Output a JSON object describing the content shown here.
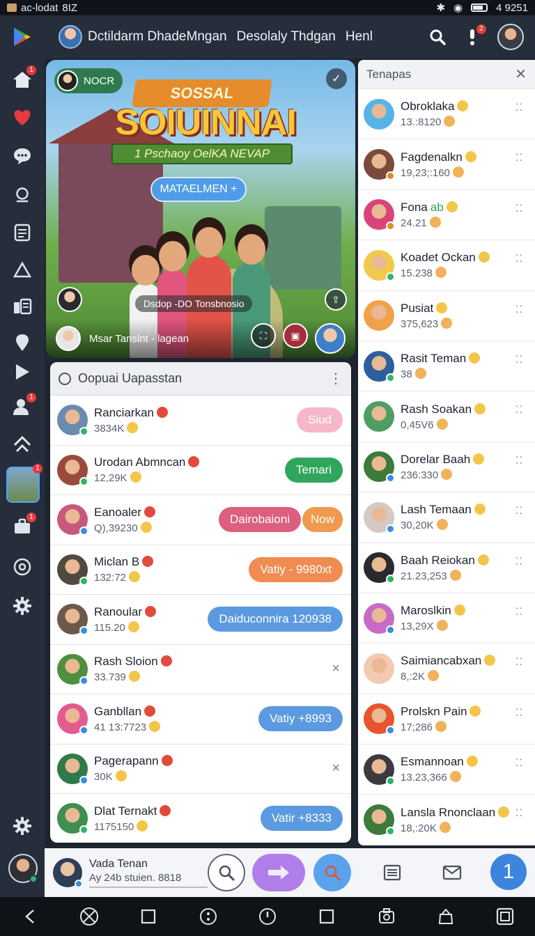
{
  "status_bar": {
    "carrier": "ac-lodat",
    "network": "8IZ",
    "time": "4 9251"
  },
  "header": {
    "title": "Dctildarm DhadeMngan",
    "subtitle": "Desolaly Thdgan",
    "extra": "Henl",
    "alerts_badge": "2"
  },
  "rail": {
    "home_badge": "1",
    "thumb_badge": "1",
    "briefcase_badge": "1"
  },
  "hero": {
    "chip_label": "NOCR",
    "banner": "SOSSAL",
    "title": "SOIUINNAI",
    "subtitle": "1 Pschaoy OelKA NEVAP",
    "pill": "MATAELMEN",
    "caption": "Dsdop -DO Tonsbnosio",
    "footer_name": "Msar Tanslnt - lagean"
  },
  "panel": {
    "title": "Oopuai Uapasstan",
    "rows": [
      {
        "name": "Ranciarkan",
        "sub": "3834K",
        "pill": "Siud",
        "pill_color": "#f6b8c8",
        "avatar": "#6b8ab0",
        "status": "#2fb46a"
      },
      {
        "name": "Urodan Abmncan",
        "sub": "12,29K",
        "pill": "Temari",
        "pill_color": "#2fa65b",
        "avatar": "#9a4a3c",
        "status": "#2fb46a"
      },
      {
        "name": "Eanoaler",
        "sub": "Q),39230",
        "pill": "Dairobaioni",
        "pill_color": "#dc5f7e",
        "pill2": "Now",
        "pill2_color": "#ef9a4e",
        "avatar": "#c65a7c",
        "status": "#3a8de0"
      },
      {
        "name": "Miclan B",
        "sub": "132:72",
        "pill": "Vatiy - 9980xt",
        "pill_color": "#f08c52",
        "avatar": "#4e4a40",
        "status": "#2fb46a"
      },
      {
        "name": "Ranoular",
        "sub": "115.20",
        "pill": "Daiduconnira 120938",
        "pill_color": "#5b9ae0",
        "avatar": "#6b5a4a",
        "status": "#3a8de0"
      },
      {
        "name": "Rash Sloion",
        "sub": "33.739",
        "close": "×",
        "avatar": "#4f8f3e",
        "status": "#3a8de0"
      },
      {
        "name": "Ganbllan",
        "sub": "41 13:7723",
        "pill": "Vatiy +8993",
        "pill_color": "#5b9ae0",
        "avatar": "#e35c8f",
        "status": "#3a8de0"
      },
      {
        "name": "Pagerapann",
        "sub": "30K",
        "close": "×",
        "avatar": "#2f7a4a",
        "status": "#3a8de0"
      },
      {
        "name": "Dlat Ternakt",
        "sub": "1175150",
        "pill": "Vatir +8333",
        "pill_color": "#5b9ae0",
        "avatar": "#3f8e52",
        "status": "#2fb46a"
      }
    ]
  },
  "right_panel": {
    "title": "Tenapas",
    "rows": [
      {
        "name": "Obroklaka",
        "sub": "13.:8120",
        "avatar": "#56b3e8",
        "status": ""
      },
      {
        "name": "Fagdenalkn",
        "sub": "19,23;:160",
        "avatar": "#7a4a3a",
        "status": "#e08a2c"
      },
      {
        "name": "Fona",
        "tag": "ab",
        "sub": "24.21",
        "avatar": "#d9457a",
        "status": "#e08a2c"
      },
      {
        "name": "Koadet Ockan",
        "sub": "15.238",
        "avatar": "#f2c94c",
        "status": "#2fb46a"
      },
      {
        "name": "Pusiat",
        "sub": "375,623",
        "avatar": "#f0a24a",
        "status": ""
      },
      {
        "name": "Rasit Teman",
        "sub": "38",
        "avatar": "#2d5e9e",
        "status": "#2fb46a"
      },
      {
        "name": "Rash Soakan",
        "sub": "0,45V6",
        "avatar": "#4f9d62",
        "status": ""
      },
      {
        "name": "Dorelar Baah",
        "sub": "236:330",
        "avatar": "#3e7a3a",
        "status": "#3a8de0"
      },
      {
        "name": "Lash Temaan",
        "sub": "30,20K",
        "avatar": "#d6c8c2",
        "status": "#3a8de0"
      },
      {
        "name": "Baah Reiokan",
        "sub": "21.23,253",
        "avatar": "#2a2a2e",
        "status": "#2fb46a"
      },
      {
        "name": "Maroslkin",
        "sub": "13,29X",
        "avatar": "#c86ac8",
        "status": "#3a8de0"
      },
      {
        "name": "Saimiancabxan",
        "sub": "8,:2K",
        "avatar": "#f3c9b2",
        "status": ""
      },
      {
        "name": "Prolskn Pain",
        "sub": "17;286",
        "avatar": "#e9532e",
        "status": "#3a8de0"
      },
      {
        "name": "Esmannoan",
        "sub": "13.23,366",
        "avatar": "#3b3a40",
        "status": "#2fb46a"
      },
      {
        "name": "Lansla Rnonclaan",
        "sub": "18,:20K",
        "avatar": "#3d7a3c",
        "status": "#2fb46a"
      }
    ]
  },
  "appbar": {
    "name": "Vada Tenan",
    "sub": "Ay 24b stuien. 8818",
    "counter": "1"
  },
  "colors": {
    "rail_bg": "#262d3b",
    "accent_blue": "#3a8de0",
    "accent_purple": "#b07ee8"
  }
}
